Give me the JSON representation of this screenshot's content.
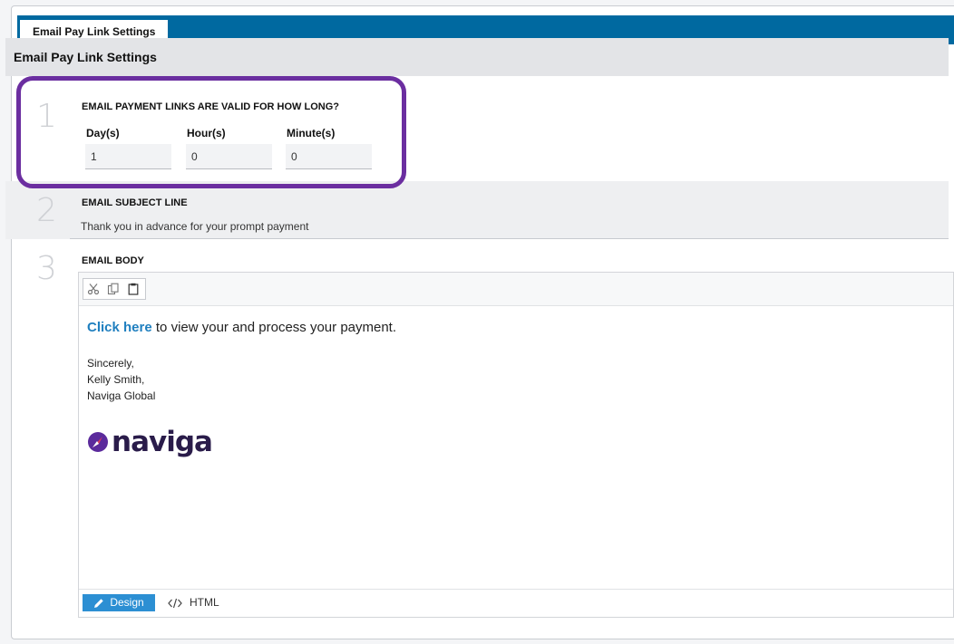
{
  "tabs": [
    {
      "label": "Email Pay Link Settings"
    }
  ],
  "panel": {
    "title": "Email Pay Link Settings"
  },
  "sections": {
    "validity": {
      "step": "1",
      "label": "EMAIL PAYMENT LINKS ARE VALID FOR HOW LONG?",
      "fields": {
        "days": {
          "label": "Day(s)",
          "value": "1"
        },
        "hours": {
          "label": "Hour(s)",
          "value": "0"
        },
        "minutes": {
          "label": "Minute(s)",
          "value": "0"
        }
      }
    },
    "subject": {
      "step": "2",
      "label": "EMAIL SUBJECT LINE",
      "value": "Thank you in advance for your prompt payment"
    },
    "body": {
      "step": "3",
      "label": "EMAIL BODY",
      "toolbar": {
        "icons": [
          "cut-icon",
          "copy-icon",
          "paste-icon"
        ]
      },
      "content": {
        "link_text": "Click here",
        "link_rest": " to view your and process your payment.",
        "signoff": "Sincerely,",
        "name": "Kelly Smith,",
        "company": "Naviga Global",
        "logo_text": "naviga"
      },
      "modes": {
        "design_label": "Design",
        "html_label": "HTML"
      }
    }
  },
  "colors": {
    "accent": "#0069a0",
    "highlight": "#6b2ea0",
    "link": "#1f7fbf",
    "button": "#2c8fd3"
  }
}
